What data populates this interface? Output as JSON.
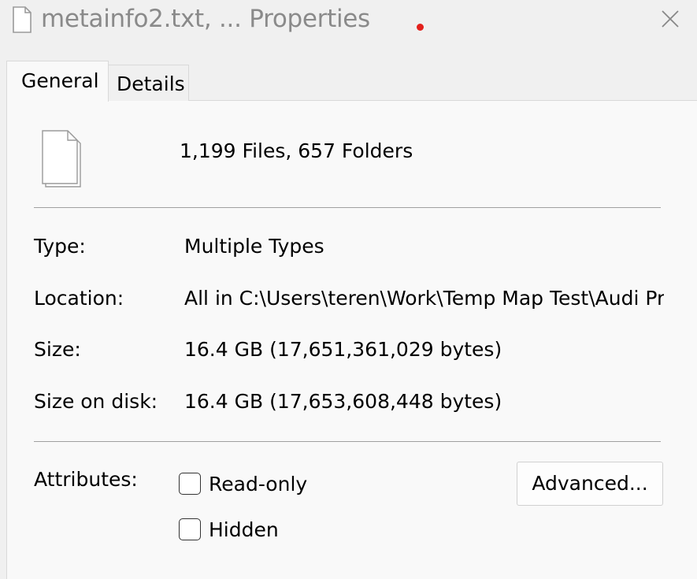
{
  "window": {
    "title": "metainfo2.txt, ... Properties",
    "title_icon": "document-icon",
    "close_icon": "close-icon",
    "accent_dot_color": "#e3201c"
  },
  "tabs": [
    {
      "label": "General",
      "selected": true
    },
    {
      "label": "Details",
      "selected": false
    }
  ],
  "general": {
    "icon": "multiple-documents-icon",
    "summary": "1,199 Files, 657 Folders",
    "fields": {
      "type": {
        "label": "Type:",
        "value": "Multiple Types"
      },
      "location": {
        "label": "Location:",
        "value": "All in C:\\Users\\teren\\Work\\Temp Map Test\\Audi Pre"
      },
      "size": {
        "label": "Size:",
        "value": "16.4 GB (17,651,361,029 bytes)"
      },
      "size_on_disk": {
        "label": "Size on disk:",
        "value": "16.4 GB (17,653,608,448 bytes)"
      }
    },
    "attributes": {
      "label": "Attributes:",
      "read_only": {
        "label": "Read-only",
        "checked": false
      },
      "hidden": {
        "label": "Hidden",
        "checked": false
      },
      "advanced_button": "Advanced..."
    }
  }
}
